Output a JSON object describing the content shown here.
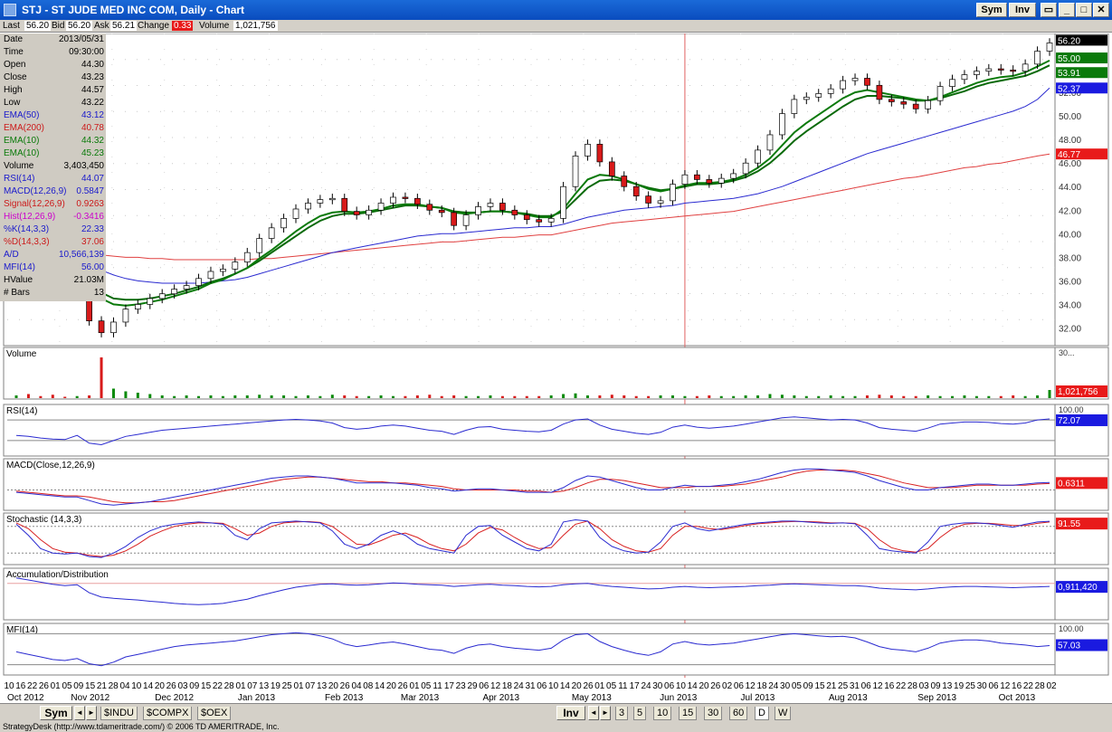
{
  "window": {
    "title": "STJ - ST JUDE MED INC COM, Daily - Chart",
    "sym_label": "Sym",
    "inv_label": "Inv",
    "minimize": "_",
    "maximize": "□",
    "close": "✕",
    "restore": "▭"
  },
  "status": {
    "last_label": "Last",
    "last": "56.20",
    "bid_label": "Bid",
    "bid": "56.20",
    "ask_label": "Ask",
    "ask": "56.21",
    "change_label": "Change",
    "change": "0.33",
    "volume_label": "Volume",
    "volume": "1,021,756"
  },
  "data_window": [
    {
      "label": "Date",
      "value": "2013/05/31",
      "color": "#000000"
    },
    {
      "label": "Time",
      "value": "09:30:00",
      "color": "#000000"
    },
    {
      "label": "Open",
      "value": "44.30",
      "color": "#000000"
    },
    {
      "label": "Close",
      "value": "43.23",
      "color": "#000000"
    },
    {
      "label": "High",
      "value": "44.57",
      "color": "#000000"
    },
    {
      "label": "Low",
      "value": "43.22",
      "color": "#000000"
    },
    {
      "label": "EMA(50)",
      "value": "43.12",
      "color": "#1a1acc"
    },
    {
      "label": "EMA(200)",
      "value": "40.78",
      "color": "#cc1a1a"
    },
    {
      "label": "EMA(10)",
      "value": "44.32",
      "color": "#0a7a0a"
    },
    {
      "label": "EMA(10)",
      "value": "45.23",
      "color": "#0a7a0a"
    },
    {
      "label": "Volume",
      "value": "3,403,450",
      "color": "#000000"
    },
    {
      "label": "RSI(14)",
      "value": "44.07",
      "color": "#1a1acc"
    },
    {
      "label": "MACD(12,26,9)",
      "value": "0.5847",
      "color": "#1a1acc"
    },
    {
      "label": "Signal(12,26,9)",
      "value": "0.9263",
      "color": "#cc1a1a"
    },
    {
      "label": "Hist(12,26,9)",
      "value": "-0.3416",
      "color": "#cc00cc"
    },
    {
      "label": "%K(14,3,3)",
      "value": "22.33",
      "color": "#1a1acc"
    },
    {
      "label": "%D(14,3,3)",
      "value": "37.06",
      "color": "#cc1a1a"
    },
    {
      "label": "A/D",
      "value": "10,566,139",
      "color": "#1a1acc"
    },
    {
      "label": "MFI(14)",
      "value": "56.00",
      "color": "#1a1acc"
    },
    {
      "label": "HValue",
      "value": "21.03M",
      "color": "#000000"
    },
    {
      "label": "# Bars",
      "value": "13",
      "color": "#000000"
    }
  ],
  "price_panel": {
    "y_ticks": [
      "52.00",
      "50.00",
      "48.00",
      "46.00",
      "44.00",
      "42.00",
      "40.00",
      "38.00",
      "36.00",
      "34.00",
      "32.00"
    ],
    "labels": [
      {
        "text": "56.20",
        "bg": "#000000",
        "fg": "#ffffff"
      },
      {
        "text": "55.00",
        "bg": "#0a7a0a",
        "fg": "#ffffff"
      },
      {
        "text": "53.91",
        "bg": "#0a7a0a",
        "fg": "#ffffff"
      },
      {
        "text": "52.37",
        "bg": "#1a1ae0",
        "fg": "#ffffff"
      },
      {
        "text": "46.77",
        "bg": "#e81a1a",
        "fg": "#ffffff"
      }
    ]
  },
  "panels": {
    "volume": {
      "title": "Volume",
      "value": "1,021,756",
      "value_bg": "#e81a1a",
      "tick": "30..."
    },
    "rsi": {
      "title": "RSI(14)",
      "value": "72.07",
      "value_bg": "#1a1ae0",
      "top_tick": "100.00"
    },
    "macd": {
      "title": "MACD(Close,12,26,9)",
      "value": "0.6311",
      "value_bg": "#e81a1a"
    },
    "stoch": {
      "title": "Stochastic (14,3,3)",
      "value": "91.55",
      "value_bg": "#e81a1a"
    },
    "ad": {
      "title": "Accumulation/Distribution",
      "value": "0,911,420",
      "value_bg": "#1a1ae0"
    },
    "mfi": {
      "title": "MFI(14)",
      "value": "57.03",
      "value_bg": "#1a1ae0",
      "top_tick": "100.00"
    }
  },
  "x_axis": {
    "days": [
      "10",
      "16",
      "22",
      "26",
      "01",
      "05",
      "09",
      "15",
      "21",
      "28",
      "04",
      "10",
      "14",
      "20",
      "26",
      "03",
      "09",
      "15",
      "22",
      "28",
      "01",
      "07",
      "13",
      "19",
      "25",
      "01",
      "07",
      "13",
      "20",
      "26",
      "04",
      "08",
      "14",
      "20",
      "26",
      "01",
      "05",
      "11",
      "17",
      "23",
      "29",
      "06",
      "12",
      "18",
      "24",
      "31",
      "06",
      "10",
      "14",
      "20",
      "26",
      "01",
      "05",
      "11",
      "17",
      "24",
      "30",
      "06",
      "10",
      "14",
      "20",
      "26",
      "02",
      "06",
      "12",
      "18",
      "24",
      "30",
      "05",
      "09",
      "15",
      "21",
      "25",
      "31",
      "06",
      "12",
      "16",
      "22",
      "28",
      "03",
      "09",
      "13",
      "19",
      "25",
      "30",
      "06",
      "12",
      "16",
      "22",
      "28",
      "02"
    ],
    "months": [
      {
        "label": "Oct 2012",
        "pos": 0.0
      },
      {
        "label": "Nov 2012",
        "pos": 0.063
      },
      {
        "label": "Dec 2012",
        "pos": 0.146
      },
      {
        "label": "Jan 2013",
        "pos": 0.228
      },
      {
        "label": "Feb 2013",
        "pos": 0.314
      },
      {
        "label": "Mar 2013",
        "pos": 0.389
      },
      {
        "label": "Apr 2013",
        "pos": 0.47
      },
      {
        "label": "May 2013",
        "pos": 0.558
      },
      {
        "label": "Jun 2013",
        "pos": 0.645
      },
      {
        "label": "Jul 2013",
        "pos": 0.725
      },
      {
        "label": "Aug 2013",
        "pos": 0.812
      },
      {
        "label": "Sep 2013",
        "pos": 0.9
      },
      {
        "label": "Oct 2013",
        "pos": 0.98
      }
    ]
  },
  "bottom_bar": {
    "sym_label": "Sym",
    "inv_label": "Inv",
    "symbol_tabs": [
      "$INDU",
      "$COMPX",
      "$OEX"
    ],
    "interval_tabs": [
      "3",
      "5",
      "10",
      "15",
      "30",
      "60",
      "D",
      "W"
    ],
    "active_interval": "D",
    "left_arrow": "◄",
    "right_arrow": "►"
  },
  "footer": {
    "text": "StrategyDesk (http://www.tdameritrade.com/) © 2006 TD AMERITRADE, Inc."
  },
  "chart_data": {
    "type": "candlestick",
    "title": "STJ - ST JUDE MED INC COM, Daily",
    "ylim": [
      30.5,
      57
    ],
    "close": [
      37.2,
      36.4,
      35.9,
      35.4,
      35.0,
      36.1,
      32.6,
      31.6,
      32.5,
      33.6,
      34.0,
      34.5,
      34.9,
      35.3,
      35.6,
      36.2,
      36.8,
      37.0,
      37.6,
      38.4,
      39.6,
      40.5,
      41.3,
      42.1,
      42.6,
      42.9,
      43.0,
      41.9,
      41.6,
      42.0,
      42.6,
      43.1,
      43.0,
      42.5,
      42.0,
      41.8,
      40.7,
      41.6,
      42.3,
      42.6,
      42.0,
      41.6,
      41.2,
      41.0,
      41.3,
      44.0,
      46.6,
      47.6,
      46.1,
      44.9,
      44.0,
      43.2,
      42.6,
      42.8,
      44.2,
      45.0,
      44.6,
      44.3,
      44.7,
      45.1,
      46.0,
      47.1,
      48.4,
      50.2,
      51.4,
      51.6,
      51.9,
      52.3,
      53.0,
      53.2,
      52.6,
      51.4,
      51.2,
      51.0,
      50.6,
      51.3,
      52.5,
      53.1,
      53.5,
      53.8,
      54.0,
      53.9,
      53.8,
      54.4,
      55.5,
      56.2
    ],
    "ema10": [
      37.4,
      36.9,
      36.5,
      36.2,
      35.9,
      35.8,
      35.3,
      34.5,
      34.0,
      33.9,
      34.0,
      34.2,
      34.4,
      34.7,
      35.0,
      35.3,
      35.8,
      36.1,
      36.6,
      37.1,
      37.9,
      38.6,
      39.4,
      40.2,
      40.9,
      41.5,
      41.8,
      41.9,
      41.8,
      41.9,
      42.1,
      42.4,
      42.5,
      42.5,
      42.3,
      42.2,
      41.8,
      41.7,
      41.8,
      41.9,
      41.9,
      41.8,
      41.6,
      41.4,
      41.4,
      42.1,
      43.4,
      44.6,
      45.0,
      44.9,
      44.6,
      44.2,
      43.8,
      43.6,
      43.8,
      44.1,
      44.3,
      44.3,
      44.4,
      44.6,
      45.0,
      45.6,
      46.4,
      47.5,
      48.6,
      49.4,
      50.1,
      50.8,
      51.5,
      52.0,
      52.2,
      52.0,
      51.8,
      51.6,
      51.4,
      51.3,
      51.6,
      52.0,
      52.4,
      52.8,
      53.1,
      53.3,
      53.4,
      53.7,
      54.2,
      54.7
    ],
    "ema10b": [
      37.7,
      37.3,
      36.9,
      36.6,
      36.3,
      36.2,
      35.8,
      35.0,
      34.5,
      34.4,
      34.4,
      34.5,
      34.7,
      34.9,
      35.2,
      35.5,
      35.9,
      36.2,
      36.6,
      37.1,
      37.7,
      38.4,
      39.1,
      39.8,
      40.5,
      41.1,
      41.5,
      41.7,
      41.7,
      41.8,
      42.0,
      42.2,
      42.4,
      42.4,
      42.3,
      42.2,
      41.9,
      41.8,
      41.8,
      41.9,
      41.9,
      41.8,
      41.7,
      41.5,
      41.5,
      41.9,
      42.9,
      43.9,
      44.5,
      44.6,
      44.5,
      44.2,
      43.9,
      43.7,
      43.8,
      44.0,
      44.2,
      44.2,
      44.3,
      44.5,
      44.8,
      45.3,
      46.0,
      46.9,
      47.9,
      48.7,
      49.4,
      50.1,
      50.8,
      51.4,
      51.7,
      51.7,
      51.6,
      51.5,
      51.3,
      51.3,
      51.5,
      51.8,
      52.1,
      52.5,
      52.8,
      53.0,
      53.2,
      53.4,
      53.8,
      54.3
    ],
    "ema50": [
      39.2,
      38.9,
      38.6,
      38.3,
      38.0,
      37.8,
      37.4,
      36.9,
      36.5,
      36.2,
      36.0,
      35.9,
      35.8,
      35.8,
      35.8,
      35.8,
      35.9,
      36.0,
      36.1,
      36.3,
      36.6,
      36.9,
      37.2,
      37.5,
      37.8,
      38.1,
      38.4,
      38.6,
      38.8,
      39.0,
      39.2,
      39.4,
      39.6,
      39.8,
      39.9,
      40.0,
      40.0,
      40.1,
      40.2,
      40.3,
      40.4,
      40.5,
      40.5,
      40.6,
      40.6,
      40.8,
      41.1,
      41.4,
      41.6,
      41.8,
      42.0,
      42.1,
      42.2,
      42.3,
      42.4,
      42.6,
      42.7,
      42.8,
      42.9,
      43.0,
      43.2,
      43.4,
      43.7,
      44.0,
      44.4,
      44.8,
      45.2,
      45.6,
      46.0,
      46.4,
      46.8,
      47.1,
      47.4,
      47.7,
      48.0,
      48.3,
      48.6,
      48.9,
      49.2,
      49.5,
      49.8,
      50.1,
      50.4,
      50.8,
      51.4,
      52.37
    ],
    "ema200": [
      38.8,
      38.7,
      38.6,
      38.5,
      38.4,
      38.4,
      38.3,
      38.2,
      38.1,
      38.0,
      38.0,
      37.9,
      37.9,
      37.8,
      37.8,
      37.8,
      37.8,
      37.8,
      37.8,
      37.8,
      37.9,
      37.9,
      38.0,
      38.1,
      38.2,
      38.3,
      38.4,
      38.5,
      38.6,
      38.7,
      38.8,
      38.9,
      39.0,
      39.1,
      39.2,
      39.3,
      39.3,
      39.4,
      39.5,
      39.6,
      39.7,
      39.7,
      39.8,
      39.9,
      39.9,
      40.1,
      40.3,
      40.5,
      40.7,
      40.9,
      41.0,
      41.1,
      41.2,
      41.3,
      41.4,
      41.5,
      41.6,
      41.7,
      41.8,
      41.9,
      42.1,
      42.3,
      42.5,
      42.7,
      42.9,
      43.1,
      43.3,
      43.5,
      43.7,
      43.9,
      44.1,
      44.3,
      44.5,
      44.7,
      44.8,
      45.0,
      45.2,
      45.4,
      45.6,
      45.7,
      45.9,
      46.0,
      46.2,
      46.4,
      46.6,
      46.77
    ],
    "volume": [
      4,
      6,
      3,
      5,
      2,
      3,
      4,
      60,
      14,
      10,
      8,
      6,
      4,
      3,
      4,
      3,
      4,
      3,
      4,
      4,
      5,
      4,
      4,
      3,
      4,
      3,
      5,
      4,
      3,
      3,
      4,
      3,
      3,
      4,
      5,
      3,
      4,
      3,
      3,
      4,
      3,
      3,
      3,
      3,
      4,
      6,
      7,
      4,
      4,
      5,
      4,
      3,
      3,
      4,
      4,
      3,
      3,
      4,
      3,
      3,
      4,
      4,
      6,
      5,
      4,
      3,
      3,
      4,
      3,
      3,
      4,
      5,
      4,
      3,
      3,
      4,
      3,
      3,
      4,
      3,
      3,
      3,
      4,
      3,
      4,
      12
    ],
    "rsi": [
      40,
      38,
      35,
      33,
      32,
      40,
      25,
      22,
      30,
      38,
      42,
      46,
      50,
      52,
      54,
      56,
      58,
      60,
      62,
      64,
      66,
      68,
      70,
      71,
      70,
      68,
      64,
      55,
      52,
      54,
      58,
      60,
      58,
      54,
      50,
      48,
      42,
      50,
      56,
      57,
      52,
      50,
      48,
      47,
      50,
      62,
      70,
      72,
      60,
      52,
      48,
      44,
      42,
      46,
      56,
      60,
      56,
      54,
      56,
      58,
      62,
      66,
      70,
      74,
      76,
      74,
      72,
      70,
      71,
      70,
      64,
      55,
      52,
      50,
      48,
      54,
      62,
      64,
      66,
      66,
      65,
      63,
      62,
      64,
      70,
      72
    ],
    "macd": [
      -0.2,
      -0.3,
      -0.4,
      -0.5,
      -0.6,
      -0.6,
      -0.9,
      -1.2,
      -1.3,
      -1.2,
      -1.1,
      -1.0,
      -0.8,
      -0.6,
      -0.4,
      -0.2,
      0.0,
      0.2,
      0.4,
      0.6,
      0.8,
      1.0,
      1.1,
      1.2,
      1.2,
      1.1,
      1.0,
      0.8,
      0.6,
      0.6,
      0.6,
      0.6,
      0.5,
      0.4,
      0.2,
      0.1,
      -0.1,
      0.0,
      0.1,
      0.1,
      0.0,
      -0.1,
      -0.2,
      -0.2,
      -0.2,
      0.2,
      0.8,
      1.2,
      1.1,
      0.8,
      0.5,
      0.2,
      0.0,
      0.0,
      0.2,
      0.4,
      0.3,
      0.3,
      0.4,
      0.5,
      0.7,
      0.9,
      1.2,
      1.5,
      1.7,
      1.8,
      1.8,
      1.7,
      1.6,
      1.5,
      1.2,
      0.8,
      0.5,
      0.2,
      0.0,
      0.0,
      0.2,
      0.3,
      0.4,
      0.5,
      0.5,
      0.4,
      0.4,
      0.5,
      0.6,
      0.63
    ],
    "signal": [
      -0.1,
      -0.2,
      -0.3,
      -0.4,
      -0.5,
      -0.5,
      -0.6,
      -0.8,
      -1.0,
      -1.1,
      -1.1,
      -1.0,
      -1.0,
      -0.9,
      -0.7,
      -0.5,
      -0.3,
      -0.1,
      0.1,
      0.3,
      0.5,
      0.7,
      0.9,
      1.0,
      1.1,
      1.1,
      1.0,
      0.9,
      0.8,
      0.7,
      0.7,
      0.6,
      0.6,
      0.5,
      0.4,
      0.3,
      0.1,
      0.0,
      0.0,
      0.0,
      0.0,
      0.0,
      -0.1,
      -0.1,
      -0.2,
      -0.1,
      0.2,
      0.6,
      0.9,
      0.9,
      0.8,
      0.6,
      0.4,
      0.2,
      0.2,
      0.2,
      0.3,
      0.3,
      0.3,
      0.4,
      0.5,
      0.7,
      0.9,
      1.1,
      1.4,
      1.6,
      1.7,
      1.7,
      1.7,
      1.6,
      1.4,
      1.2,
      0.9,
      0.6,
      0.4,
      0.2,
      0.2,
      0.2,
      0.3,
      0.4,
      0.4,
      0.4,
      0.4,
      0.4,
      0.5,
      0.55
    ],
    "stoch_k": [
      85,
      60,
      30,
      20,
      18,
      20,
      12,
      10,
      20,
      35,
      55,
      70,
      80,
      85,
      88,
      90,
      88,
      85,
      60,
      50,
      75,
      88,
      90,
      92,
      90,
      88,
      70,
      40,
      30,
      40,
      60,
      70,
      60,
      40,
      30,
      25,
      20,
      60,
      80,
      82,
      60,
      45,
      30,
      25,
      40,
      90,
      95,
      92,
      55,
      35,
      25,
      20,
      22,
      45,
      80,
      88,
      75,
      70,
      75,
      80,
      85,
      88,
      90,
      92,
      92,
      90,
      88,
      87,
      88,
      86,
      60,
      30,
      25,
      22,
      20,
      45,
      80,
      85,
      88,
      88,
      86,
      82,
      78,
      85,
      90,
      91.55
    ],
    "stoch_d": [
      88,
      75,
      50,
      30,
      22,
      20,
      15,
      12,
      15,
      25,
      40,
      58,
      70,
      80,
      85,
      88,
      88,
      87,
      75,
      60,
      65,
      80,
      88,
      90,
      91,
      89,
      80,
      60,
      40,
      38,
      48,
      60,
      65,
      55,
      40,
      30,
      25,
      40,
      65,
      78,
      72,
      55,
      40,
      30,
      32,
      60,
      85,
      92,
      75,
      50,
      35,
      25,
      22,
      30,
      60,
      80,
      80,
      75,
      73,
      77,
      82,
      86,
      88,
      90,
      91,
      91,
      90,
      88,
      88,
      87,
      75,
      50,
      32,
      25,
      22,
      30,
      55,
      75,
      85,
      87,
      87,
      85,
      82,
      82,
      87,
      90
    ],
    "ad": [
      0.9,
      0.85,
      0.8,
      0.75,
      0.72,
      0.74,
      0.55,
      0.45,
      0.42,
      0.4,
      0.38,
      0.35,
      0.33,
      0.3,
      0.28,
      0.27,
      0.28,
      0.3,
      0.35,
      0.4,
      0.48,
      0.55,
      0.62,
      0.68,
      0.72,
      0.75,
      0.76,
      0.74,
      0.73,
      0.74,
      0.76,
      0.78,
      0.77,
      0.75,
      0.74,
      0.73,
      0.7,
      0.72,
      0.74,
      0.75,
      0.73,
      0.72,
      0.7,
      0.69,
      0.7,
      0.74,
      0.76,
      0.77,
      0.73,
      0.7,
      0.68,
      0.66,
      0.64,
      0.65,
      0.68,
      0.7,
      0.68,
      0.67,
      0.68,
      0.69,
      0.7,
      0.72,
      0.73,
      0.75,
      0.76,
      0.75,
      0.74,
      0.73,
      0.72,
      0.72,
      0.7,
      0.66,
      0.64,
      0.63,
      0.62,
      0.64,
      0.67,
      0.69,
      0.7,
      0.7,
      0.69,
      0.68,
      0.67,
      0.68,
      0.69,
      0.7
    ],
    "mfi": [
      45,
      40,
      35,
      30,
      28,
      32,
      22,
      18,
      25,
      35,
      40,
      45,
      50,
      55,
      58,
      60,
      62,
      64,
      66,
      70,
      74,
      78,
      80,
      82,
      80,
      76,
      70,
      60,
      55,
      58,
      62,
      64,
      60,
      55,
      50,
      48,
      42,
      52,
      58,
      60,
      55,
      52,
      50,
      48,
      52,
      68,
      78,
      80,
      65,
      55,
      48,
      42,
      38,
      45,
      60,
      65,
      60,
      58,
      60,
      62,
      66,
      70,
      74,
      78,
      80,
      78,
      76,
      74,
      75,
      72,
      64,
      55,
      50,
      48,
      45,
      52,
      62,
      66,
      68,
      68,
      66,
      62,
      60,
      58,
      55,
      57.03
    ]
  }
}
